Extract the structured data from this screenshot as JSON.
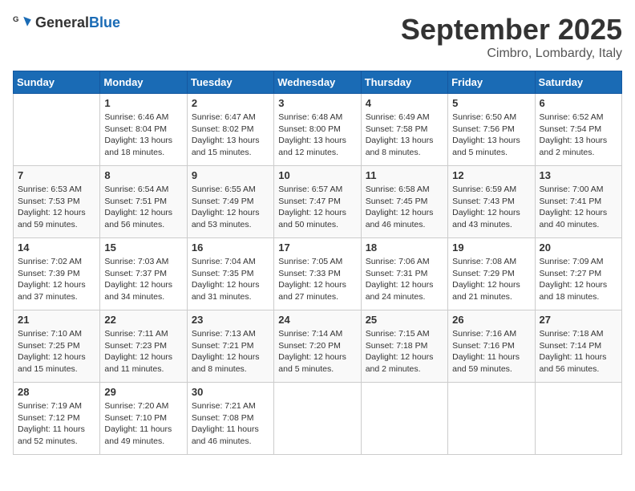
{
  "header": {
    "logo_general": "General",
    "logo_blue": "Blue",
    "month": "September 2025",
    "location": "Cimbro, Lombardy, Italy"
  },
  "weekdays": [
    "Sunday",
    "Monday",
    "Tuesday",
    "Wednesday",
    "Thursday",
    "Friday",
    "Saturday"
  ],
  "weeks": [
    [
      {
        "day": "",
        "info": ""
      },
      {
        "day": "1",
        "info": "Sunrise: 6:46 AM\nSunset: 8:04 PM\nDaylight: 13 hours\nand 18 minutes."
      },
      {
        "day": "2",
        "info": "Sunrise: 6:47 AM\nSunset: 8:02 PM\nDaylight: 13 hours\nand 15 minutes."
      },
      {
        "day": "3",
        "info": "Sunrise: 6:48 AM\nSunset: 8:00 PM\nDaylight: 13 hours\nand 12 minutes."
      },
      {
        "day": "4",
        "info": "Sunrise: 6:49 AM\nSunset: 7:58 PM\nDaylight: 13 hours\nand 8 minutes."
      },
      {
        "day": "5",
        "info": "Sunrise: 6:50 AM\nSunset: 7:56 PM\nDaylight: 13 hours\nand 5 minutes."
      },
      {
        "day": "6",
        "info": "Sunrise: 6:52 AM\nSunset: 7:54 PM\nDaylight: 13 hours\nand 2 minutes."
      }
    ],
    [
      {
        "day": "7",
        "info": "Sunrise: 6:53 AM\nSunset: 7:53 PM\nDaylight: 12 hours\nand 59 minutes."
      },
      {
        "day": "8",
        "info": "Sunrise: 6:54 AM\nSunset: 7:51 PM\nDaylight: 12 hours\nand 56 minutes."
      },
      {
        "day": "9",
        "info": "Sunrise: 6:55 AM\nSunset: 7:49 PM\nDaylight: 12 hours\nand 53 minutes."
      },
      {
        "day": "10",
        "info": "Sunrise: 6:57 AM\nSunset: 7:47 PM\nDaylight: 12 hours\nand 50 minutes."
      },
      {
        "day": "11",
        "info": "Sunrise: 6:58 AM\nSunset: 7:45 PM\nDaylight: 12 hours\nand 46 minutes."
      },
      {
        "day": "12",
        "info": "Sunrise: 6:59 AM\nSunset: 7:43 PM\nDaylight: 12 hours\nand 43 minutes."
      },
      {
        "day": "13",
        "info": "Sunrise: 7:00 AM\nSunset: 7:41 PM\nDaylight: 12 hours\nand 40 minutes."
      }
    ],
    [
      {
        "day": "14",
        "info": "Sunrise: 7:02 AM\nSunset: 7:39 PM\nDaylight: 12 hours\nand 37 minutes."
      },
      {
        "day": "15",
        "info": "Sunrise: 7:03 AM\nSunset: 7:37 PM\nDaylight: 12 hours\nand 34 minutes."
      },
      {
        "day": "16",
        "info": "Sunrise: 7:04 AM\nSunset: 7:35 PM\nDaylight: 12 hours\nand 31 minutes."
      },
      {
        "day": "17",
        "info": "Sunrise: 7:05 AM\nSunset: 7:33 PM\nDaylight: 12 hours\nand 27 minutes."
      },
      {
        "day": "18",
        "info": "Sunrise: 7:06 AM\nSunset: 7:31 PM\nDaylight: 12 hours\nand 24 minutes."
      },
      {
        "day": "19",
        "info": "Sunrise: 7:08 AM\nSunset: 7:29 PM\nDaylight: 12 hours\nand 21 minutes."
      },
      {
        "day": "20",
        "info": "Sunrise: 7:09 AM\nSunset: 7:27 PM\nDaylight: 12 hours\nand 18 minutes."
      }
    ],
    [
      {
        "day": "21",
        "info": "Sunrise: 7:10 AM\nSunset: 7:25 PM\nDaylight: 12 hours\nand 15 minutes."
      },
      {
        "day": "22",
        "info": "Sunrise: 7:11 AM\nSunset: 7:23 PM\nDaylight: 12 hours\nand 11 minutes."
      },
      {
        "day": "23",
        "info": "Sunrise: 7:13 AM\nSunset: 7:21 PM\nDaylight: 12 hours\nand 8 minutes."
      },
      {
        "day": "24",
        "info": "Sunrise: 7:14 AM\nSunset: 7:20 PM\nDaylight: 12 hours\nand 5 minutes."
      },
      {
        "day": "25",
        "info": "Sunrise: 7:15 AM\nSunset: 7:18 PM\nDaylight: 12 hours\nand 2 minutes."
      },
      {
        "day": "26",
        "info": "Sunrise: 7:16 AM\nSunset: 7:16 PM\nDaylight: 11 hours\nand 59 minutes."
      },
      {
        "day": "27",
        "info": "Sunrise: 7:18 AM\nSunset: 7:14 PM\nDaylight: 11 hours\nand 56 minutes."
      }
    ],
    [
      {
        "day": "28",
        "info": "Sunrise: 7:19 AM\nSunset: 7:12 PM\nDaylight: 11 hours\nand 52 minutes."
      },
      {
        "day": "29",
        "info": "Sunrise: 7:20 AM\nSunset: 7:10 PM\nDaylight: 11 hours\nand 49 minutes."
      },
      {
        "day": "30",
        "info": "Sunrise: 7:21 AM\nSunset: 7:08 PM\nDaylight: 11 hours\nand 46 minutes."
      },
      {
        "day": "",
        "info": ""
      },
      {
        "day": "",
        "info": ""
      },
      {
        "day": "",
        "info": ""
      },
      {
        "day": "",
        "info": ""
      }
    ]
  ]
}
